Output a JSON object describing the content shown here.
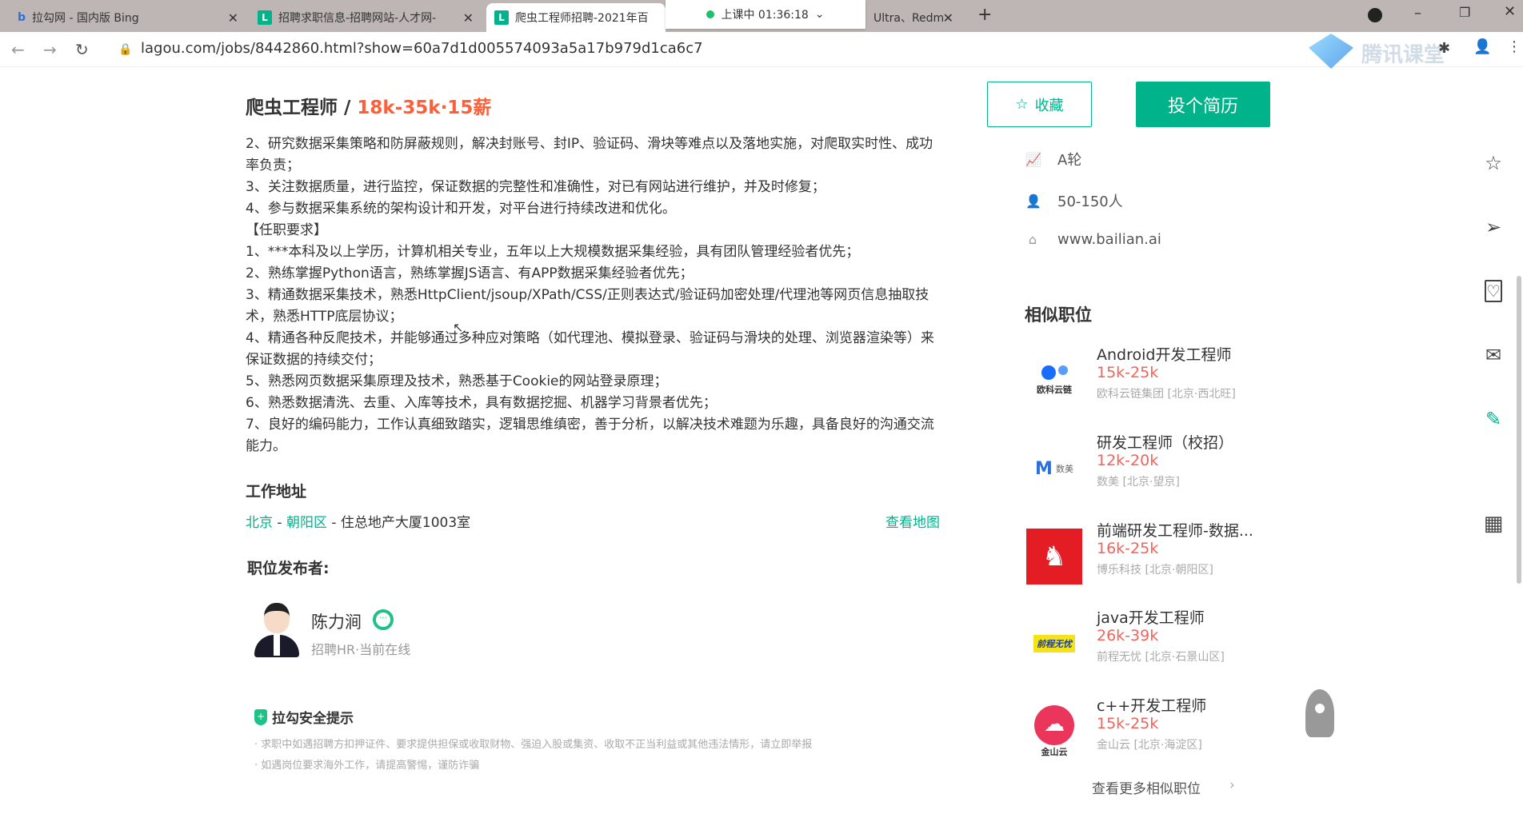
{
  "browser": {
    "tabs": [
      {
        "label": "拉勾网 - 国内版 Bing",
        "icon": "bing-icon"
      },
      {
        "label": "招聘求职信息-招聘网站-人才网-",
        "icon": "lagou-icon"
      },
      {
        "label": "爬虫工程师招聘-2021年百",
        "icon": "lagou-icon",
        "active": true
      },
      {
        "label": "Ultra、Redm",
        "icon": "none"
      }
    ],
    "favicon_letter": "L",
    "live_status": "上课中 01:36:18",
    "url": "lagou.com/jobs/8442860.html?show=60a7d1d005574093a5a17b979d1ca6c7",
    "overlay_logo_text": "腾讯课堂"
  },
  "job": {
    "title": "爬虫工程师",
    "separator": " / ",
    "salary": "18k-35k·15薪",
    "collect_label": "收藏",
    "apply_label": "投个简历"
  },
  "description": [
    "2、研究数据采集策略和防屏蔽规则，解决封账号、封IP、验证码、滑块等难点以及落地实施，对爬取实时性、成功率负责；",
    "3、关注数据质量，进行监控，保证数据的完整性和准确性，对已有网站进行维护，并及时修复；",
    "4、参与数据采集系统的架构设计和开发，对平台进行持续改进和优化。",
    "【任职要求】",
    "1、***本科及以上学历，计算机相关专业，五年以上大规模数据采集经验，具有团队管理经验者优先；",
    "2、熟练掌握Python语言，熟练掌握JS语言、有APP数据采集经验者优先；",
    "3、精通数据采集技术，熟悉HttpClient/jsoup/XPath/CSS/正则表达式/验证码加密处理/代理池等网页信息抽取技术，熟悉HTTP底层协议；",
    "4、精通各种反爬技术，并能够通过多种应对策略（如代理池、模拟登录、验证码与滑块的处理、浏览器渲染等）来保证数据的持续交付；",
    "5、熟悉网页数据采集原理及技术，熟悉基于Cookie的网站登录原理；",
    "6、熟悉数据清洗、去重、入库等技术，具有数据挖掘、机器学习背景者优先；",
    "7、良好的编码能力，工作认真细致踏实，逻辑思维缜密，善于分析，以解决技术难题为乐趣，具备良好的沟通交流能力。"
  ],
  "address": {
    "heading": "工作地址",
    "city": "北京",
    "district": "朝阳区",
    "detail": "住总地产大厦1003室",
    "sep": " - ",
    "map_link": "查看地图"
  },
  "publisher": {
    "heading": "职位发布者:",
    "name": "陈力涧",
    "role": "招聘HR·当前在线"
  },
  "safety": {
    "heading": "拉勾安全提示",
    "tips": [
      "· 求职中如遇招聘方扣押证件、要求提供担保或收取财物、强迫入股或集资、收取不正当利益或其他违法情形，请立即举报",
      "· 如遇岗位要求海外工作，请提高警惕，谨防诈骗"
    ]
  },
  "company": {
    "stage": "A轮",
    "size": "50-150人",
    "website": "www.bailian.ai"
  },
  "similar": {
    "heading": "相似职位",
    "items": [
      {
        "title": "Android开发工程师",
        "salary": "15k-25k",
        "company": "欧科云链集团 [北京·西北旺]",
        "logo_text": "欧科云链"
      },
      {
        "title": "研发工程师（校招）",
        "salary": "12k-20k",
        "company": "数美 [北京·望京]",
        "logo_text": "数美"
      },
      {
        "title": "前端研发工程师-数据...",
        "salary": "16k-25k",
        "company": "博乐科技 [北京·朝阳区]",
        "logo_text": ""
      },
      {
        "title": "java开发工程师",
        "salary": "26k-39k",
        "company": "前程无忧 [北京·石景山区]",
        "logo_text": "前程无忧"
      },
      {
        "title": "c++开发工程师",
        "salary": "15k-25k",
        "company": "金山云 [北京·海淀区]",
        "logo_text": "金山云"
      }
    ],
    "more_label": "查看更多相似职位"
  },
  "colors": {
    "brand": "#00b38a",
    "salary": "#fd5f39"
  }
}
